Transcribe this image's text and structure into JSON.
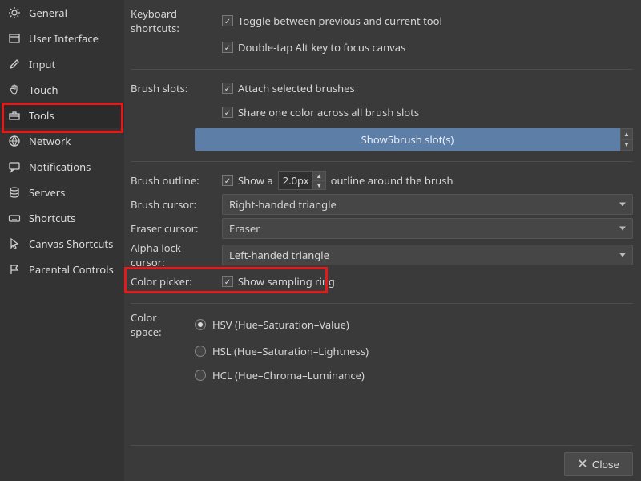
{
  "sidebar": {
    "items": [
      {
        "label": "General"
      },
      {
        "label": "User Interface"
      },
      {
        "label": "Input"
      },
      {
        "label": "Touch"
      },
      {
        "label": "Tools"
      },
      {
        "label": "Network"
      },
      {
        "label": "Notifications"
      },
      {
        "label": "Servers"
      },
      {
        "label": "Shortcuts"
      },
      {
        "label": "Canvas Shortcuts"
      },
      {
        "label": "Parental Controls"
      }
    ]
  },
  "keyboard": {
    "label": "Keyboard shortcuts:",
    "toggle": "Toggle between previous and current tool",
    "doubletap": "Double-tap Alt key to focus canvas"
  },
  "brushslots": {
    "label": "Brush slots:",
    "attach": "Attach selected brushes",
    "share": "Share one color across all brush slots",
    "show_prefix": "Show ",
    "show_count": "5",
    "show_suffix": " brush slot(s)"
  },
  "outline": {
    "label": "Brush outline:",
    "show_prefix": "Show a",
    "value": "2.0px",
    "suffix": "outline around the brush"
  },
  "brushcursor": {
    "label": "Brush cursor:",
    "value": "Right-handed triangle"
  },
  "erasercursor": {
    "label": "Eraser cursor:",
    "value": "Eraser"
  },
  "alphacursor": {
    "label": "Alpha lock cursor:",
    "value": "Left-handed triangle"
  },
  "colorpicker": {
    "label": "Color picker:",
    "option": "Show sampling ring"
  },
  "colorspace": {
    "label": "Color space:",
    "hsv": "HSV (Hue–Saturation–Value)",
    "hsl": "HSL (Hue–Saturation–Lightness)",
    "hcl": "HCL (Hue–Chroma–Luminance)"
  },
  "footer": {
    "close": "Close"
  }
}
